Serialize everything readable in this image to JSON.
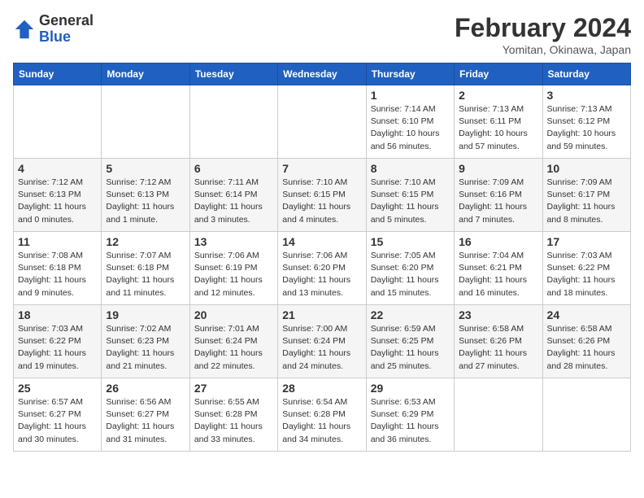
{
  "header": {
    "logo_general": "General",
    "logo_blue": "Blue",
    "month_year": "February 2024",
    "location": "Yomitan, Okinawa, Japan"
  },
  "weekdays": [
    "Sunday",
    "Monday",
    "Tuesday",
    "Wednesday",
    "Thursday",
    "Friday",
    "Saturday"
  ],
  "weeks": [
    [
      {
        "day": "",
        "info": ""
      },
      {
        "day": "",
        "info": ""
      },
      {
        "day": "",
        "info": ""
      },
      {
        "day": "",
        "info": ""
      },
      {
        "day": "1",
        "info": "Sunrise: 7:14 AM\nSunset: 6:10 PM\nDaylight: 10 hours\nand 56 minutes."
      },
      {
        "day": "2",
        "info": "Sunrise: 7:13 AM\nSunset: 6:11 PM\nDaylight: 10 hours\nand 57 minutes."
      },
      {
        "day": "3",
        "info": "Sunrise: 7:13 AM\nSunset: 6:12 PM\nDaylight: 10 hours\nand 59 minutes."
      }
    ],
    [
      {
        "day": "4",
        "info": "Sunrise: 7:12 AM\nSunset: 6:13 PM\nDaylight: 11 hours\nand 0 minutes."
      },
      {
        "day": "5",
        "info": "Sunrise: 7:12 AM\nSunset: 6:13 PM\nDaylight: 11 hours\nand 1 minute."
      },
      {
        "day": "6",
        "info": "Sunrise: 7:11 AM\nSunset: 6:14 PM\nDaylight: 11 hours\nand 3 minutes."
      },
      {
        "day": "7",
        "info": "Sunrise: 7:10 AM\nSunset: 6:15 PM\nDaylight: 11 hours\nand 4 minutes."
      },
      {
        "day": "8",
        "info": "Sunrise: 7:10 AM\nSunset: 6:15 PM\nDaylight: 11 hours\nand 5 minutes."
      },
      {
        "day": "9",
        "info": "Sunrise: 7:09 AM\nSunset: 6:16 PM\nDaylight: 11 hours\nand 7 minutes."
      },
      {
        "day": "10",
        "info": "Sunrise: 7:09 AM\nSunset: 6:17 PM\nDaylight: 11 hours\nand 8 minutes."
      }
    ],
    [
      {
        "day": "11",
        "info": "Sunrise: 7:08 AM\nSunset: 6:18 PM\nDaylight: 11 hours\nand 9 minutes."
      },
      {
        "day": "12",
        "info": "Sunrise: 7:07 AM\nSunset: 6:18 PM\nDaylight: 11 hours\nand 11 minutes."
      },
      {
        "day": "13",
        "info": "Sunrise: 7:06 AM\nSunset: 6:19 PM\nDaylight: 11 hours\nand 12 minutes."
      },
      {
        "day": "14",
        "info": "Sunrise: 7:06 AM\nSunset: 6:20 PM\nDaylight: 11 hours\nand 13 minutes."
      },
      {
        "day": "15",
        "info": "Sunrise: 7:05 AM\nSunset: 6:20 PM\nDaylight: 11 hours\nand 15 minutes."
      },
      {
        "day": "16",
        "info": "Sunrise: 7:04 AM\nSunset: 6:21 PM\nDaylight: 11 hours\nand 16 minutes."
      },
      {
        "day": "17",
        "info": "Sunrise: 7:03 AM\nSunset: 6:22 PM\nDaylight: 11 hours\nand 18 minutes."
      }
    ],
    [
      {
        "day": "18",
        "info": "Sunrise: 7:03 AM\nSunset: 6:22 PM\nDaylight: 11 hours\nand 19 minutes."
      },
      {
        "day": "19",
        "info": "Sunrise: 7:02 AM\nSunset: 6:23 PM\nDaylight: 11 hours\nand 21 minutes."
      },
      {
        "day": "20",
        "info": "Sunrise: 7:01 AM\nSunset: 6:24 PM\nDaylight: 11 hours\nand 22 minutes."
      },
      {
        "day": "21",
        "info": "Sunrise: 7:00 AM\nSunset: 6:24 PM\nDaylight: 11 hours\nand 24 minutes."
      },
      {
        "day": "22",
        "info": "Sunrise: 6:59 AM\nSunset: 6:25 PM\nDaylight: 11 hours\nand 25 minutes."
      },
      {
        "day": "23",
        "info": "Sunrise: 6:58 AM\nSunset: 6:26 PM\nDaylight: 11 hours\nand 27 minutes."
      },
      {
        "day": "24",
        "info": "Sunrise: 6:58 AM\nSunset: 6:26 PM\nDaylight: 11 hours\nand 28 minutes."
      }
    ],
    [
      {
        "day": "25",
        "info": "Sunrise: 6:57 AM\nSunset: 6:27 PM\nDaylight: 11 hours\nand 30 minutes."
      },
      {
        "day": "26",
        "info": "Sunrise: 6:56 AM\nSunset: 6:27 PM\nDaylight: 11 hours\nand 31 minutes."
      },
      {
        "day": "27",
        "info": "Sunrise: 6:55 AM\nSunset: 6:28 PM\nDaylight: 11 hours\nand 33 minutes."
      },
      {
        "day": "28",
        "info": "Sunrise: 6:54 AM\nSunset: 6:28 PM\nDaylight: 11 hours\nand 34 minutes."
      },
      {
        "day": "29",
        "info": "Sunrise: 6:53 AM\nSunset: 6:29 PM\nDaylight: 11 hours\nand 36 minutes."
      },
      {
        "day": "",
        "info": ""
      },
      {
        "day": "",
        "info": ""
      }
    ]
  ]
}
